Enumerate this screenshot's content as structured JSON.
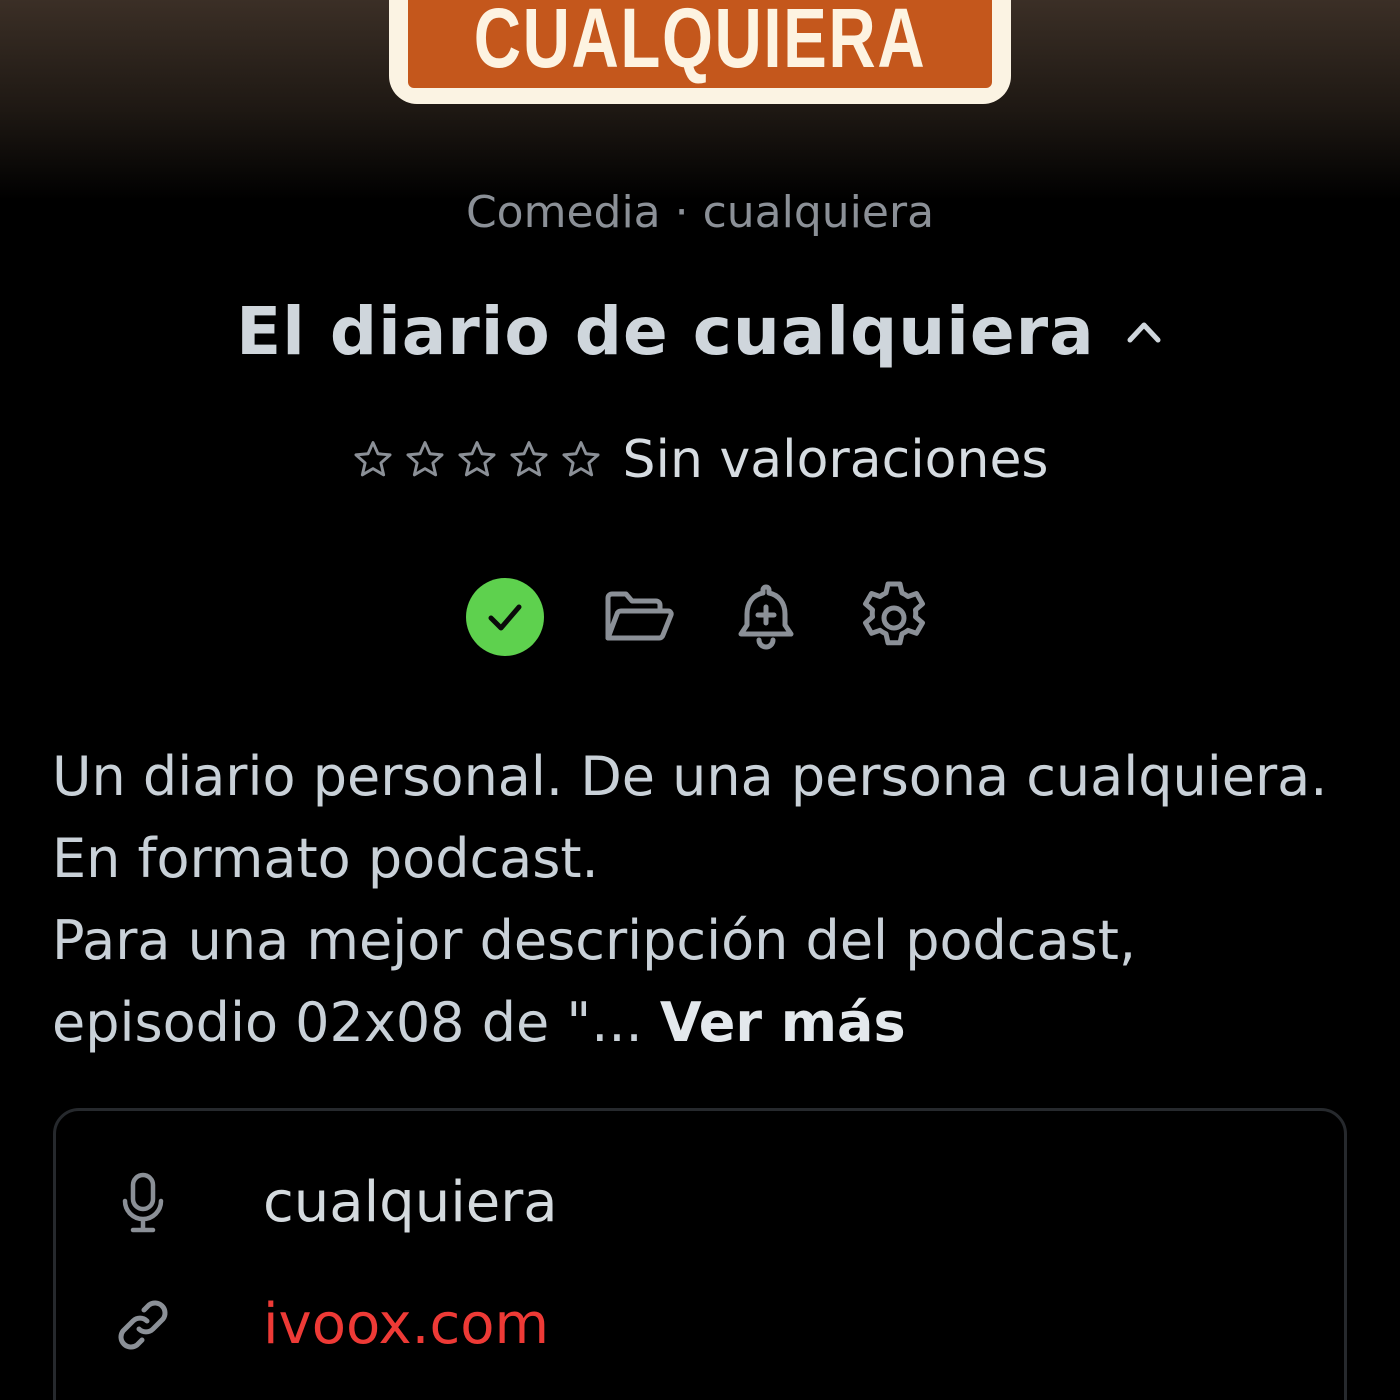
{
  "cover": {
    "text": "CUALQUIERA"
  },
  "podcast": {
    "meta": "Comedia · cualquiera",
    "title": "El diario de cualquiera",
    "rating_label": "Sin valoraciones",
    "rating_stars": 0,
    "rating_max": 5
  },
  "actions": [
    {
      "icon": "check-circle-icon",
      "state": "subscribed",
      "color": "#5ed14e"
    },
    {
      "icon": "folder-open-icon"
    },
    {
      "icon": "bell-plus-icon"
    },
    {
      "icon": "gear-icon"
    }
  ],
  "description": {
    "lines": [
      "Un diario personal. De una persona cualquiera.",
      "En formato podcast.",
      "Para una mejor descripción del podcast,",
      "episodio 02x08 de \"..."
    ],
    "more_label": "Ver más"
  },
  "info": {
    "author": {
      "icon": "microphone-icon",
      "text": "cualquiera"
    },
    "website": {
      "icon": "link-icon",
      "text": "ivoox.com",
      "color": "#ee3a36"
    }
  }
}
